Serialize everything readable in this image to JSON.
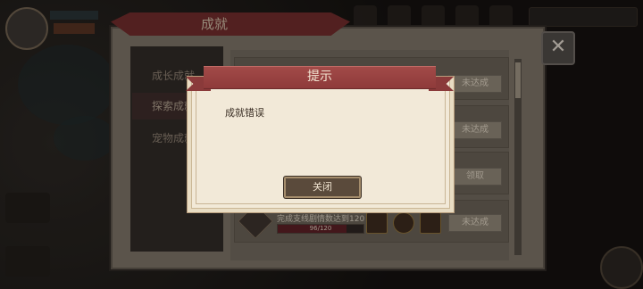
{
  "background_hud": {
    "left_top_item": "",
    "left_side_item": ""
  },
  "achievement": {
    "title": "成就",
    "close_glyph": "✕",
    "tabs": [
      {
        "label": "成长成就",
        "active": false
      },
      {
        "label": "探索成就",
        "active": true
      },
      {
        "label": "宠物成就",
        "active": false
      }
    ],
    "rows": [
      {
        "button": "未达成"
      },
      {
        "button": "未达成"
      },
      {
        "button": "领取"
      },
      {
        "button": "未达成",
        "desc": "完成支线剧情数达到120",
        "progress_text": "96/120",
        "progress": 0.8
      }
    ]
  },
  "modal": {
    "title": "提示",
    "message": "成就错误",
    "close_button": "关闭"
  },
  "colors": {
    "ribbon": "#8e3a3a",
    "modal_bg": "#f2e9d8",
    "button_bg": "#5a4a3b"
  }
}
